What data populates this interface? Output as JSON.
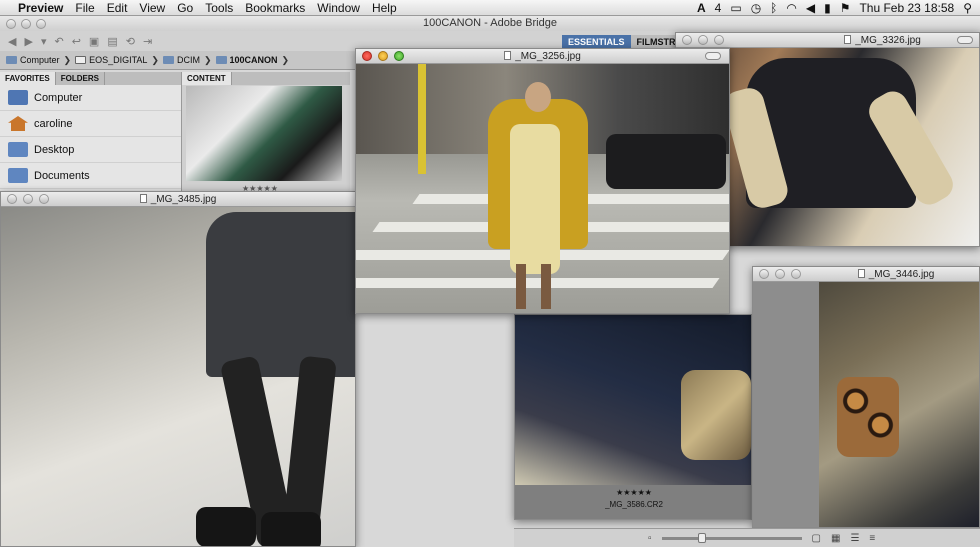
{
  "menubar": {
    "apple": "",
    "app_name": "Preview",
    "items": [
      "File",
      "Edit",
      "View",
      "Go",
      "Tools",
      "Bookmarks",
      "Window",
      "Help"
    ],
    "status": {
      "adobe_badge": "4",
      "datetime": "Thu Feb 23  18:58"
    }
  },
  "bridge": {
    "title": "100CANON - Adobe Bridge",
    "workspaces": [
      "ESSENTIALS",
      "FILMSTRIP"
    ],
    "path": [
      "Computer",
      "EOS_DIGITAL",
      "DCIM",
      "100CANON"
    ],
    "panel_tabs": [
      "FAVORITES",
      "FOLDERS"
    ],
    "content_tab": "CONTENT",
    "favorites": [
      {
        "label": "Computer",
        "icon": "computer-icon",
        "color": "#4f76b3"
      },
      {
        "label": "caroline",
        "icon": "home-icon",
        "color": "#c9762b"
      },
      {
        "label": "Desktop",
        "icon": "folder-icon",
        "color": "#5f86c0"
      },
      {
        "label": "Documents",
        "icon": "folder-icon",
        "color": "#5f86c0"
      }
    ],
    "thumb_rating": "★★★★★"
  },
  "windows": {
    "w3485": {
      "title": "_MG_3485.jpg"
    },
    "w3256": {
      "title": "_MG_3256.jpg"
    },
    "w3326": {
      "title": "_MG_3326.jpg"
    },
    "w3446": {
      "title": "_MG_3446.jpg"
    },
    "w3586": {
      "rating": "★★★★★",
      "filename": "_MG_3586.CR2"
    }
  },
  "colors": {
    "accent": "#4a72a8",
    "coat_yellow": "#c9a021"
  }
}
